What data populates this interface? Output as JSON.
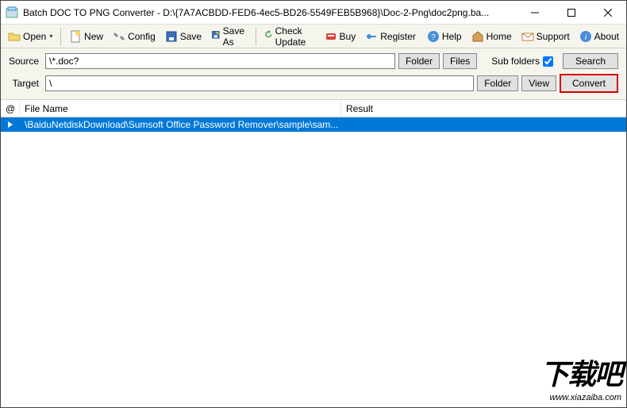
{
  "window": {
    "title": "Batch DOC TO PNG Converter - D:\\{7A7ACBDD-FED6-4ec5-BD26-5549FEB5B968}\\Doc-2-Png\\doc2png.ba..."
  },
  "toolbar": {
    "open": "Open",
    "new": "New",
    "config": "Config",
    "save": "Save",
    "saveAs": "Save As",
    "checkUpdate": "Check Update",
    "buy": "Buy",
    "register": "Register",
    "help": "Help",
    "home": "Home",
    "support": "Support",
    "about": "About"
  },
  "form": {
    "sourceLabel": "Source",
    "sourceValue": "\\*.doc?",
    "targetLabel": "Target",
    "targetValue": "\\",
    "folderBtn": "Folder",
    "filesBtn": "Files",
    "viewBtn": "View",
    "subFolders": "Sub folders",
    "searchBtn": "Search",
    "convertBtn": "Convert"
  },
  "table": {
    "colAt": "@",
    "colFile": "File Name",
    "colResult": "Result",
    "rows": [
      {
        "file": "\\BaiduNetdiskDownload\\Sumsoft Office Password Remover\\sample\\sam...",
        "result": ""
      }
    ]
  },
  "watermark": {
    "text": "下载吧",
    "url": "www.xiazaiba.com"
  }
}
